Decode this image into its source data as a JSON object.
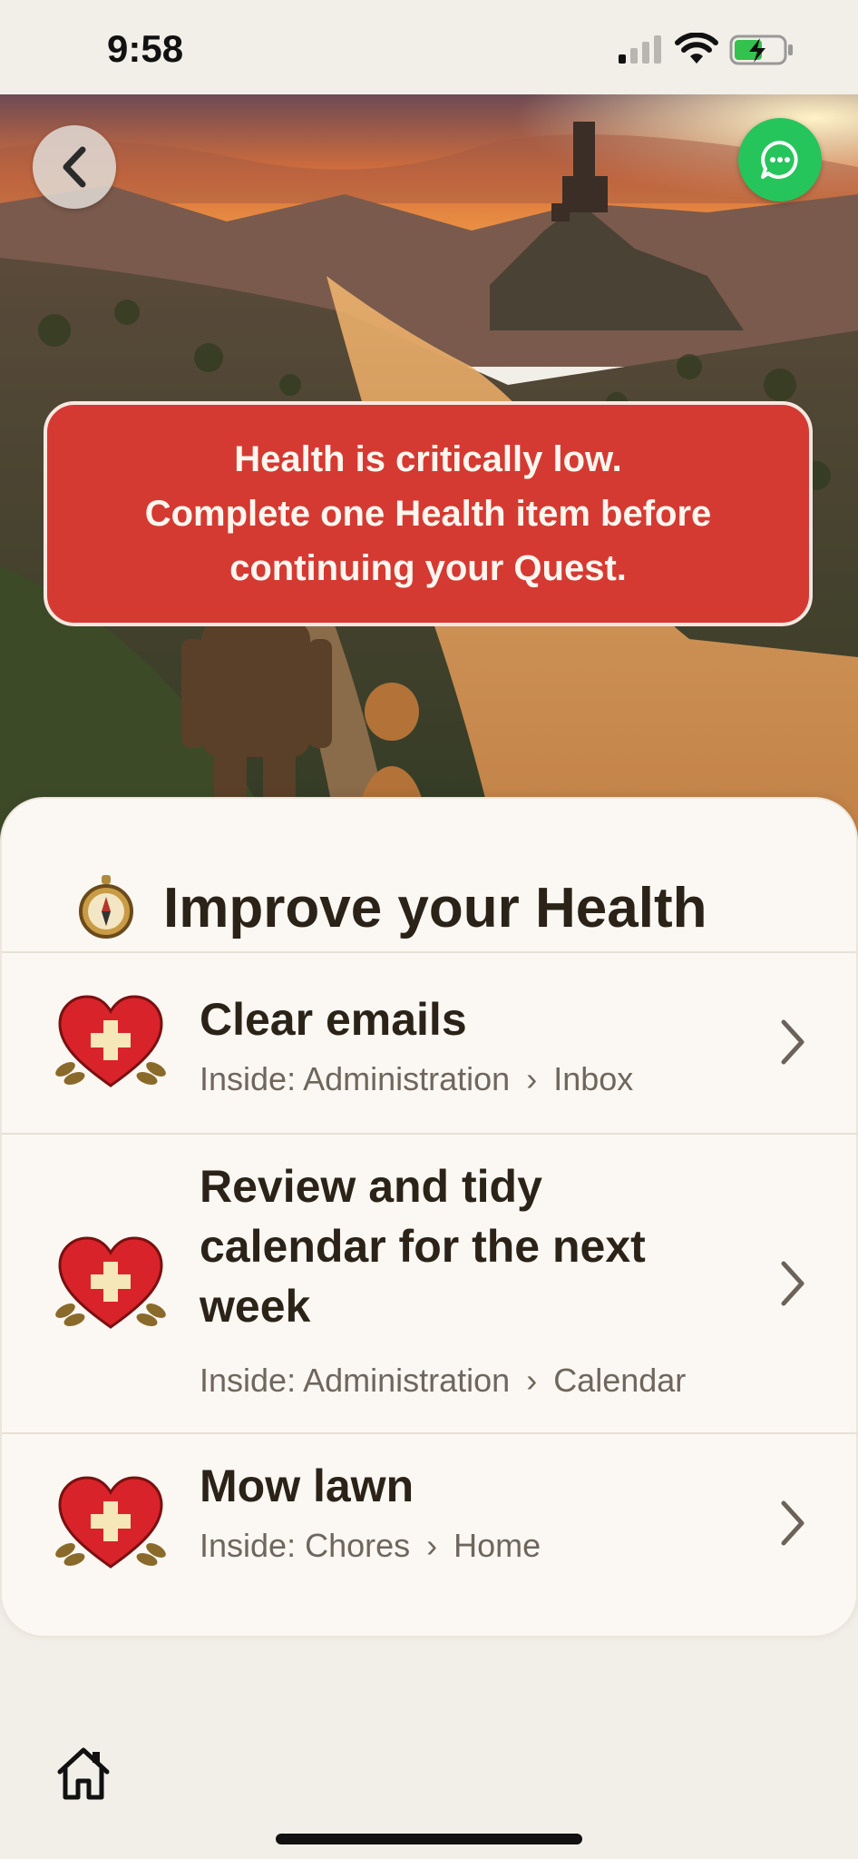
{
  "status_bar": {
    "time": "9:58"
  },
  "alert": {
    "lines": [
      "Health is critically low.",
      "Complete one Health item before",
      "continuing your Quest."
    ]
  },
  "card": {
    "title": "Improve your Health",
    "tasks": [
      {
        "title": "Clear emails",
        "path_prefix": "Inside: Administration",
        "separator": "›",
        "path_leaf": "Inbox"
      },
      {
        "title": "Review and tidy calendar for the next week",
        "path_prefix": "Inside: Administration",
        "separator": "›",
        "path_leaf": "Calendar"
      },
      {
        "title": "Mow lawn",
        "path_prefix": "Inside: Chores",
        "separator": "›",
        "path_leaf": "Home"
      }
    ]
  },
  "colors": {
    "alert_red": "#d43a32",
    "chat_green": "#25c55c",
    "card_bg": "#fbf8f3",
    "page_bg": "#f2efe9"
  },
  "icons": [
    "back-chevron-icon",
    "chat-icon",
    "compass-icon",
    "heart-health-icon",
    "chevron-right-icon",
    "home-icon"
  ]
}
